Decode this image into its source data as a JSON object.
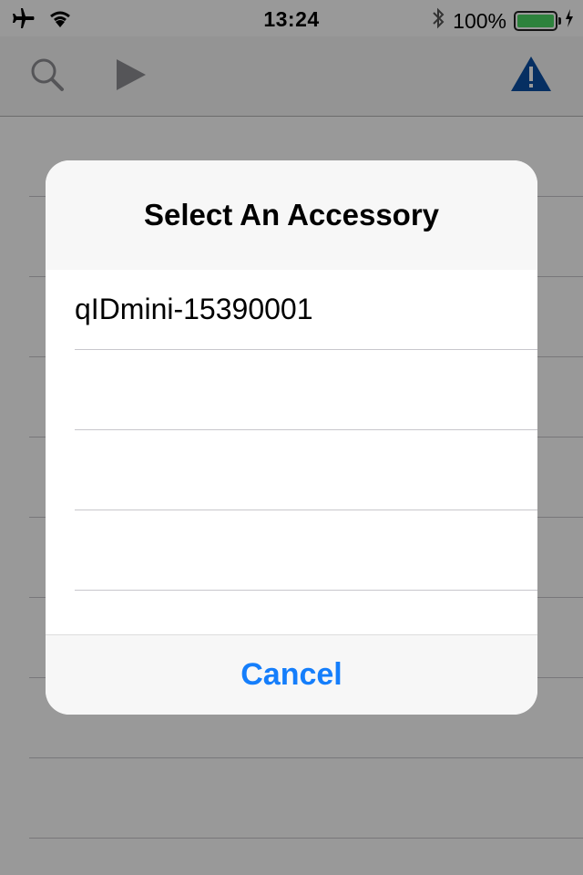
{
  "status_bar": {
    "time": "13:24",
    "battery_percent": "100%",
    "battery_level": 1.0,
    "icons": [
      "airplane-icon",
      "wifi-icon",
      "bluetooth-icon",
      "battery-icon",
      "charging-icon"
    ]
  },
  "toolbar": {
    "icons": [
      "search-icon",
      "play-icon",
      "warning-icon"
    ],
    "warning_color": "#0a4fa3"
  },
  "dialog": {
    "title": "Select An Accessory",
    "items": [
      {
        "label": "qIDmini-15390001"
      },
      {
        "label": ""
      },
      {
        "label": ""
      },
      {
        "label": ""
      },
      {
        "label": ""
      }
    ],
    "cancel_label": "Cancel",
    "accent_color": "#157efb"
  }
}
